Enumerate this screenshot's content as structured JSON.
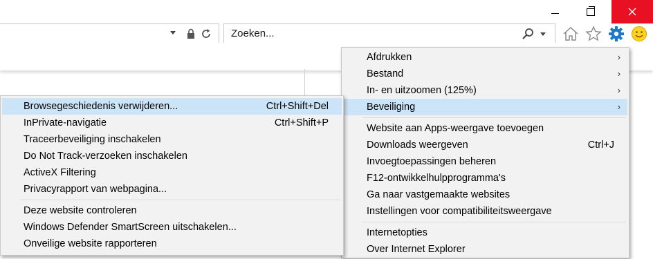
{
  "window": {
    "minimize_icon": "minimize-icon",
    "maximize_icon": "restore-icon",
    "close_icon": "close-icon",
    "close_color": "#e81123"
  },
  "address_bar": {
    "icons": [
      "dropdown-icon",
      "lock-icon",
      "refresh-icon"
    ]
  },
  "search": {
    "placeholder": "Zoeken..."
  },
  "toolbar_icons": [
    "home-icon",
    "favorites-star-icon",
    "tools-gear-icon",
    "feedback-smiley-icon"
  ],
  "tools_menu": {
    "items": [
      {
        "label": "Afdrukken",
        "submenu": true
      },
      {
        "label": "Bestand",
        "submenu": true
      },
      {
        "label": "In- en uitzoomen (125%)",
        "submenu": true
      },
      {
        "label": "Beveiliging",
        "submenu": true,
        "highlighted": true
      },
      {
        "label": "Website aan Apps-weergave toevoegen"
      },
      {
        "label": "Downloads weergeven",
        "shortcut": "Ctrl+J"
      },
      {
        "label": "Invoegtoepassingen beheren"
      },
      {
        "label": "F12-ontwikkelhulpprogramma's"
      },
      {
        "label": "Ga naar vastgemaakte websites"
      },
      {
        "label": "Instellingen voor compatibiliteitsweergave"
      },
      {
        "label": "Internetopties"
      },
      {
        "label": "Over Internet Explorer"
      }
    ]
  },
  "security_menu": {
    "items": [
      {
        "label": "Browsegeschiedenis verwijderen...",
        "shortcut": "Ctrl+Shift+Del",
        "highlighted": true
      },
      {
        "label": "InPrivate-navigatie",
        "shortcut": "Ctrl+Shift+P"
      },
      {
        "label": "Traceerbeveiliging inschakelen"
      },
      {
        "label": "Do Not Track-verzoeken inschakelen"
      },
      {
        "label": "ActiveX Filtering"
      },
      {
        "label": "Privacyrapport van webpagina..."
      },
      {
        "label": "Deze website controleren"
      },
      {
        "label": "Windows Defender SmartScreen uitschakelen..."
      },
      {
        "label": "Onveilige website rapporteren"
      }
    ]
  },
  "colors": {
    "highlight": "#cce4f7",
    "menu_bg": "#f2f2f2",
    "gear_blue": "#1e78c8",
    "smiley_yellow": "#ffd21f"
  }
}
